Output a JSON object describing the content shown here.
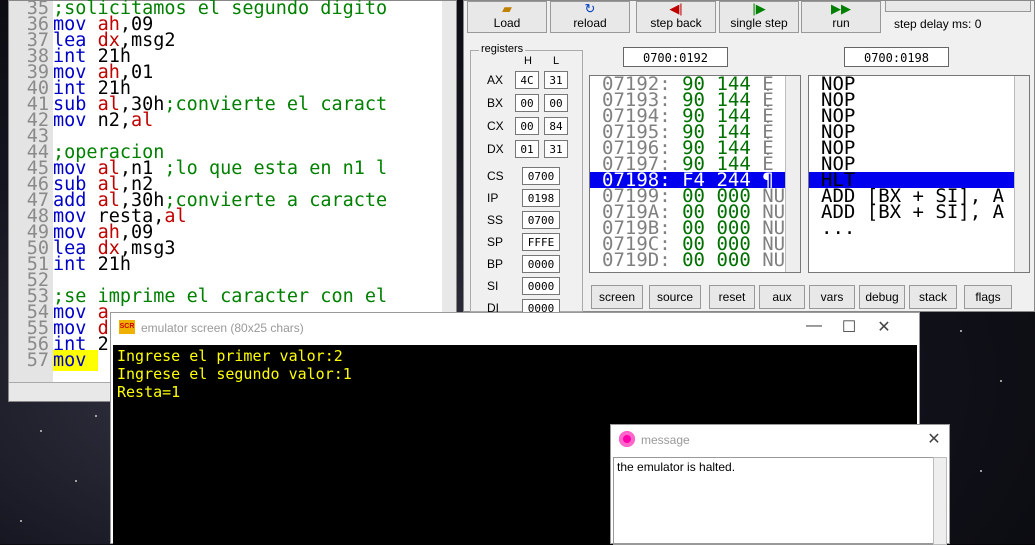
{
  "editor": {
    "lines": [
      {
        "n": "35",
        "parts": [
          [
            "cm",
            ";solicitamos el segundo digito"
          ]
        ]
      },
      {
        "n": "36",
        "parts": [
          [
            "kw",
            "mov "
          ],
          [
            "rg",
            "ah"
          ],
          [
            "tx",
            ",09"
          ]
        ]
      },
      {
        "n": "37",
        "parts": [
          [
            "kw",
            "lea "
          ],
          [
            "rg",
            "dx"
          ],
          [
            "tx",
            ",msg2"
          ]
        ]
      },
      {
        "n": "38",
        "parts": [
          [
            "kw",
            "int "
          ],
          [
            "tx",
            "21h"
          ]
        ]
      },
      {
        "n": "39",
        "parts": [
          [
            "kw",
            "mov "
          ],
          [
            "rg",
            "ah"
          ],
          [
            "tx",
            ",01"
          ]
        ]
      },
      {
        "n": "40",
        "parts": [
          [
            "kw",
            "int "
          ],
          [
            "tx",
            "21h"
          ]
        ]
      },
      {
        "n": "41",
        "parts": [
          [
            "kw",
            "sub "
          ],
          [
            "rg",
            "al"
          ],
          [
            "tx",
            ",30h"
          ],
          [
            "cm",
            ";convierte el caract"
          ]
        ]
      },
      {
        "n": "42",
        "parts": [
          [
            "kw",
            "mov "
          ],
          [
            "tx",
            "n2,"
          ],
          [
            "rg",
            "al"
          ]
        ]
      },
      {
        "n": "43",
        "parts": []
      },
      {
        "n": "44",
        "parts": [
          [
            "cm",
            ";operacion"
          ]
        ]
      },
      {
        "n": "45",
        "parts": [
          [
            "kw",
            "mov "
          ],
          [
            "rg",
            "al"
          ],
          [
            "tx",
            ",n1 "
          ],
          [
            "cm",
            ";lo que esta en n1 l"
          ]
        ]
      },
      {
        "n": "46",
        "parts": [
          [
            "kw",
            "sub "
          ],
          [
            "rg",
            "al"
          ],
          [
            "tx",
            ",n2"
          ]
        ]
      },
      {
        "n": "47",
        "parts": [
          [
            "kw",
            "add "
          ],
          [
            "rg",
            "al"
          ],
          [
            "tx",
            ",30h"
          ],
          [
            "cm",
            ";convierte a caracte"
          ]
        ]
      },
      {
        "n": "48",
        "parts": [
          [
            "kw",
            "mov "
          ],
          [
            "tx",
            "resta,"
          ],
          [
            "rg",
            "al"
          ]
        ]
      },
      {
        "n": "49",
        "parts": [
          [
            "kw",
            "mov "
          ],
          [
            "rg",
            "ah"
          ],
          [
            "tx",
            ",09"
          ]
        ]
      },
      {
        "n": "50",
        "parts": [
          [
            "kw",
            "lea "
          ],
          [
            "rg",
            "dx"
          ],
          [
            "tx",
            ",msg3"
          ]
        ]
      },
      {
        "n": "51",
        "parts": [
          [
            "kw",
            "int "
          ],
          [
            "tx",
            "21h"
          ]
        ]
      },
      {
        "n": "52",
        "parts": []
      },
      {
        "n": "53",
        "parts": [
          [
            "cm",
            ";se imprime el caracter con el"
          ]
        ]
      },
      {
        "n": "54",
        "parts": [
          [
            "kw",
            "mov "
          ],
          [
            "rg",
            "a"
          ]
        ]
      },
      {
        "n": "55",
        "parts": [
          [
            "kw",
            "mov "
          ],
          [
            "rg",
            "d"
          ]
        ]
      },
      {
        "n": "56",
        "parts": [
          [
            "kw",
            "int "
          ],
          [
            "tx",
            "2"
          ]
        ]
      },
      {
        "n": "57",
        "parts": [
          [
            "kw",
            "mov "
          ]
        ],
        "highlight": true
      }
    ]
  },
  "toolbar": {
    "load": "Load",
    "reload": "reload",
    "step_back": "step back",
    "single_step": "single step",
    "run": "run",
    "step_delay": "step delay ms: 0"
  },
  "addresses": {
    "left": "0700:0192",
    "right": "0700:0198"
  },
  "registers": {
    "title": "registers",
    "h_label": "H",
    "l_label": "L",
    "pairs": [
      {
        "name": "AX",
        "h": "4C",
        "l": "31"
      },
      {
        "name": "BX",
        "h": "00",
        "l": "00"
      },
      {
        "name": "CX",
        "h": "00",
        "l": "84"
      },
      {
        "name": "DX",
        "h": "01",
        "l": "31"
      }
    ],
    "singles": [
      {
        "name": "CS",
        "v": "0700"
      },
      {
        "name": "IP",
        "v": "0198"
      },
      {
        "name": "SS",
        "v": "0700"
      },
      {
        "name": "SP",
        "v": "FFFE"
      },
      {
        "name": "BP",
        "v": "0000"
      },
      {
        "name": "SI",
        "v": "0000"
      },
      {
        "name": "DI",
        "v": "0000"
      }
    ]
  },
  "memory": [
    {
      "addr": "07192:",
      "hex": "90",
      "dec": "144",
      "ch": "É"
    },
    {
      "addr": "07193:",
      "hex": "90",
      "dec": "144",
      "ch": "É"
    },
    {
      "addr": "07194:",
      "hex": "90",
      "dec": "144",
      "ch": "É"
    },
    {
      "addr": "07195:",
      "hex": "90",
      "dec": "144",
      "ch": "É"
    },
    {
      "addr": "07196:",
      "hex": "90",
      "dec": "144",
      "ch": "É"
    },
    {
      "addr": "07197:",
      "hex": "90",
      "dec": "144",
      "ch": "É"
    },
    {
      "addr": "07198:",
      "hex": "F4",
      "dec": "244",
      "ch": "¶",
      "selected": true
    },
    {
      "addr": "07199:",
      "hex": "00",
      "dec": "000",
      "ch": "NU"
    },
    {
      "addr": "0719A:",
      "hex": "00",
      "dec": "000",
      "ch": "NU"
    },
    {
      "addr": "0719B:",
      "hex": "00",
      "dec": "000",
      "ch": "NU"
    },
    {
      "addr": "0719C:",
      "hex": "00",
      "dec": "000",
      "ch": "NU"
    },
    {
      "addr": "0719D:",
      "hex": "00",
      "dec": "000",
      "ch": "NU"
    }
  ],
  "disasm": [
    {
      "text": "NOP"
    },
    {
      "text": "NOP"
    },
    {
      "text": "NOP"
    },
    {
      "text": "NOP"
    },
    {
      "text": "NOP"
    },
    {
      "text": "NOP"
    },
    {
      "text": "HLT",
      "selected": true
    },
    {
      "text": "ADD [BX + SI], A"
    },
    {
      "text": "ADD [BX + SI], A"
    },
    {
      "text": "..."
    }
  ],
  "bottom_buttons": [
    "screen",
    "source",
    "reset",
    "aux",
    "vars",
    "debug",
    "stack",
    "flags"
  ],
  "screen": {
    "title": "emulator screen (80x25 chars)",
    "lines": [
      "Ingrese el primer valor:2",
      "Ingrese el segundo valor:1",
      "Resta=1"
    ]
  },
  "message": {
    "title": "message",
    "text": "the emulator is halted."
  },
  "colors": {
    "selection": "#0000ee",
    "console_text": "#ffff00",
    "highlight": "#ffff00"
  }
}
